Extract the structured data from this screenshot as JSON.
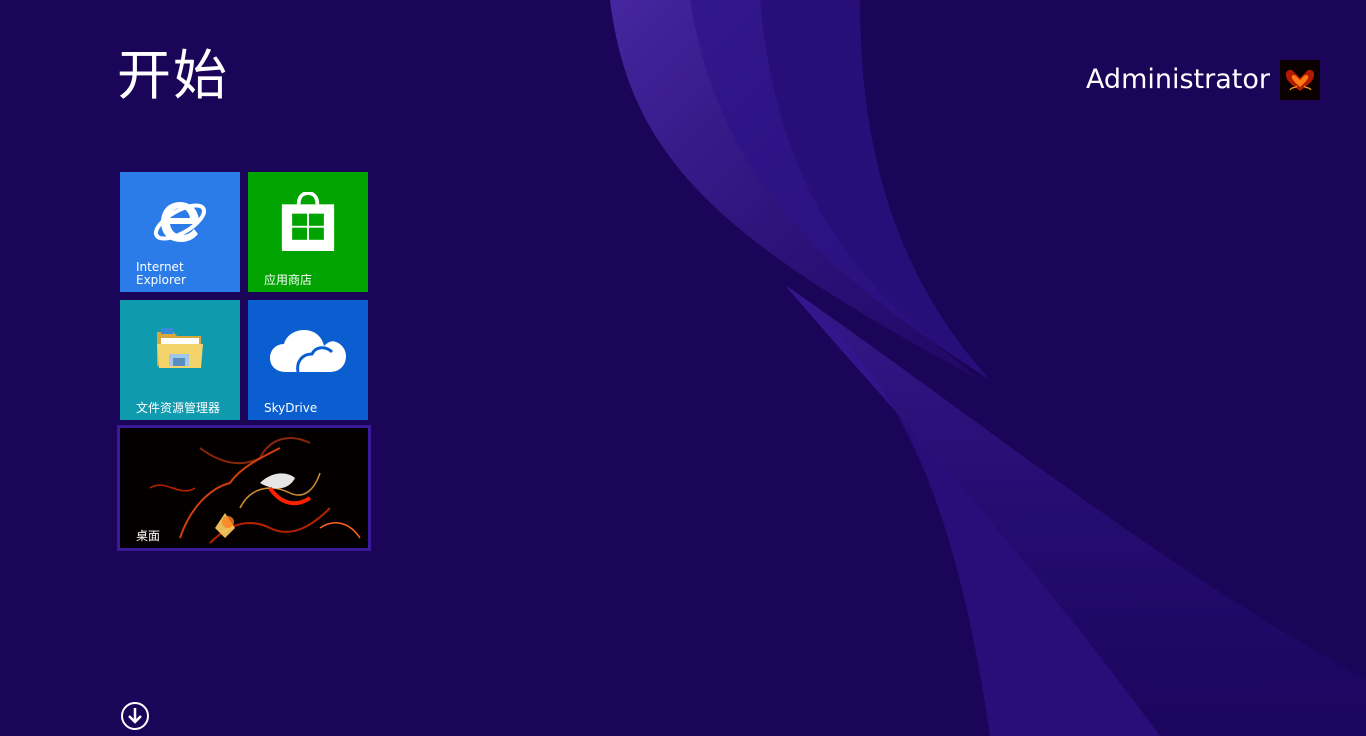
{
  "screen": {
    "title": "开始",
    "background_color": "#1b0558"
  },
  "user": {
    "name": "Administrator",
    "avatar_icon": "user-avatar-fire-love-icon"
  },
  "tiles": [
    {
      "label": "Internet\nExplorer",
      "icon": "internet-explorer-icon",
      "color": "#2b7ce9"
    },
    {
      "label": "应用商店",
      "icon": "store-bag-icon",
      "color": "#00a300"
    },
    {
      "label": "文件资源管理器",
      "icon": "folder-icon",
      "color": "#0f9aae"
    },
    {
      "label": "SkyDrive",
      "icon": "cloud-icon",
      "color": "#0a5ed0"
    },
    {
      "label": "桌面",
      "icon": "desktop-wallpaper-icon",
      "color": "#000000"
    }
  ],
  "apps_button": {
    "icon": "arrow-down-circle-icon"
  }
}
